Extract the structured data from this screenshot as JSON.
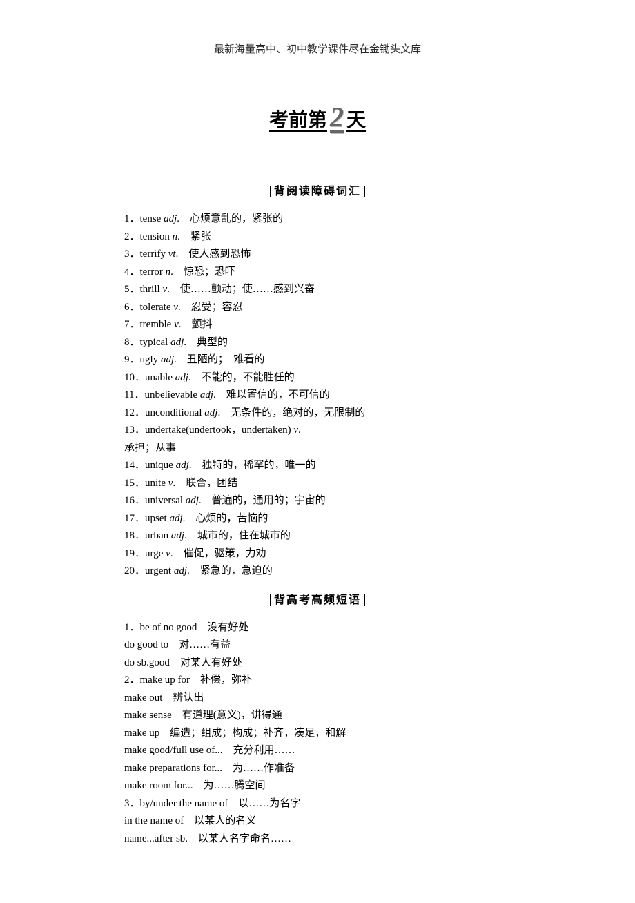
{
  "header": "最新海量高中、初中教学课件尽在金锄头文库",
  "main_title": {
    "prefix": "考前第",
    "number": "2",
    "suffix": "天"
  },
  "section1_label": "背阅读障碍词汇",
  "vocab": [
    {
      "n": "1",
      "w": "tense",
      "p": "adj",
      "t": ".　心烦意乱的，紧张的"
    },
    {
      "n": "2",
      "w": "tension",
      "p": "n",
      "t": ".　紧张"
    },
    {
      "n": "3",
      "w": "terrify",
      "p": "vt",
      "t": ".　使人感到恐怖"
    },
    {
      "n": "4",
      "w": "terror",
      "p": "n",
      "t": ".　惊恐；恐吓"
    },
    {
      "n": "5",
      "w": "thrill",
      "p": "v",
      "t": ".　使……颤动；使……感到兴奋"
    },
    {
      "n": "6",
      "w": "tolerate",
      "p": "v",
      "t": ".　忍受；容忍"
    },
    {
      "n": "7",
      "w": "tremble",
      "p": "v",
      "t": ".　颤抖"
    },
    {
      "n": "8",
      "w": "typical",
      "p": "adj",
      "t": ".　典型的"
    },
    {
      "n": "9",
      "w": "ugly",
      "p": "adj",
      "t": ".　丑陋的；　难看的"
    },
    {
      "n": "10",
      "w": "unable",
      "p": "adj",
      "t": ".　不能的，不能胜任的"
    },
    {
      "n": "11",
      "w": "unbelievable",
      "p": "adj",
      "t": ".　难以置信的，不可信的"
    },
    {
      "n": "12",
      "w": "unconditional",
      "p": "adj",
      "t": ".　无条件的，绝对的，无限制的"
    },
    {
      "n": "13",
      "w": "undertake(undertook，undertaken)",
      "p": "v",
      "t": "."
    }
  ],
  "vocab_cont_line": "承担；从事",
  "vocab2": [
    {
      "n": "14",
      "w": "unique",
      "p": "adj",
      "t": ".　独特的，稀罕的，唯一的"
    },
    {
      "n": "15",
      "w": "unite",
      "p": "v",
      "t": ".　联合，团结"
    },
    {
      "n": "16",
      "w": "universal",
      "p": "adj",
      "t": ".　普遍的，通用的；宇宙的"
    },
    {
      "n": "17",
      "w": "upset",
      "p": "adj",
      "t": ".　心烦的，苦恼的"
    },
    {
      "n": "18",
      "w": "urban",
      "p": "adj",
      "t": ".　城市的，住在城市的"
    },
    {
      "n": "19",
      "w": "urge",
      "p": "v",
      "t": ".　催促，驱策，力劝"
    },
    {
      "n": "20",
      "w": "urgent",
      "p": "adj",
      "t": ".　紧急的，急迫的"
    }
  ],
  "section2_label": "背高考高频短语",
  "phrases": [
    "1．be of no good　没有好处",
    "do good to　对……有益",
    "do sb.good　对某人有好处",
    "2．make up for　补偿，弥补",
    "make out　辨认出",
    "make sense　有道理(意义)，讲得通",
    "make up　编造；组成；构成；补齐，凑足，和解",
    "make good/full use of...　充分利用……",
    "make preparations for...　为……作准备",
    "make room for...　为……腾空间",
    "3．by/under the name of　以……为名字",
    "in the name of　以某人的名义",
    "name...after sb.　以某人名字命名……"
  ]
}
